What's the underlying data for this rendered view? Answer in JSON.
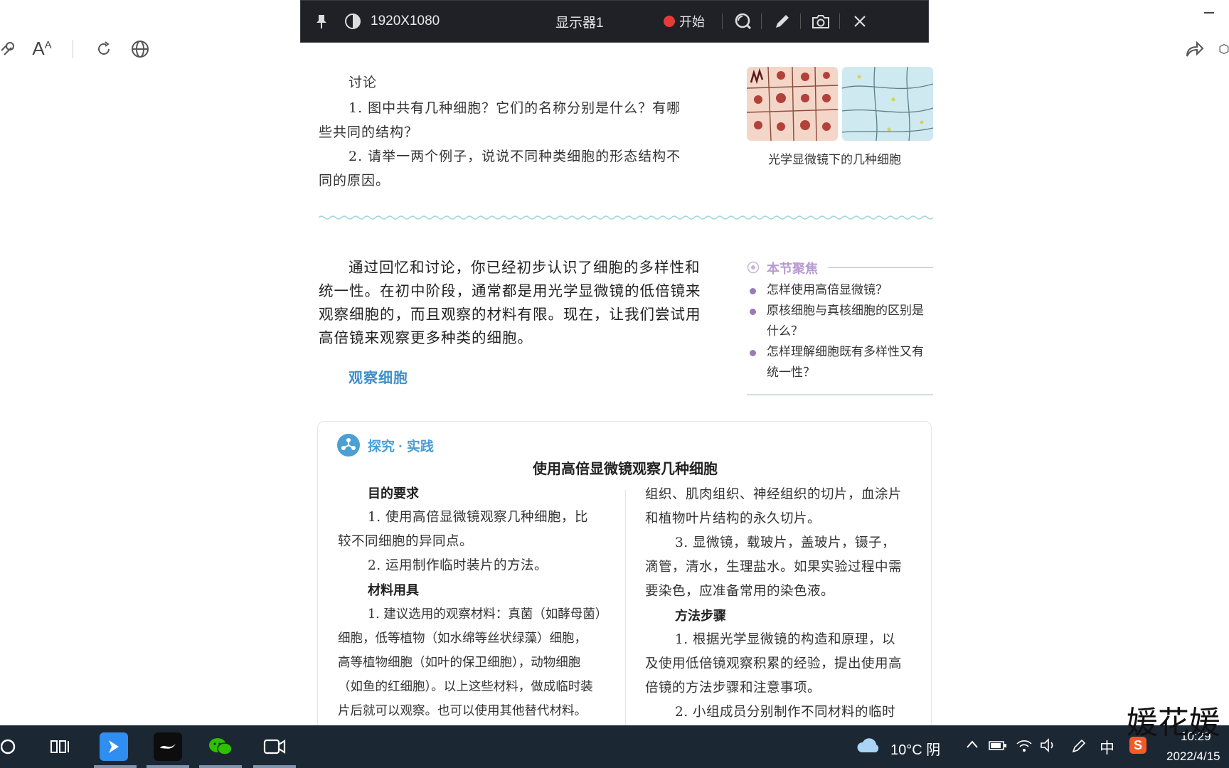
{
  "capture_toolbar": {
    "resolution": "1920X1080",
    "display": "显示器1",
    "record_label": "开始"
  },
  "page": {
    "discussion": {
      "title": "讨论",
      "q1_line1": "1. 图中共有几种细胞？它们的名称分别是什么？有哪",
      "q1_line2": "些共同的结构？",
      "q2_line1": "2. 请举一两个例子，说说不同种类细胞的形态结构不",
      "q2_line2": "同的原因。",
      "figure_caption": "光学显微镜下的几种细胞"
    },
    "intro": {
      "line1": "通过回忆和讨论，你已经初步认识了细胞的多样性和",
      "line2": "统一性。在初中阶段，通常都是用光学显微镜的低倍镜来",
      "line3": "观察细胞的，而且观察的材料有限。现在，让我们尝试用",
      "line4": "高倍镜来观察更多种类的细胞。",
      "section_title": "观察细胞"
    },
    "focus": {
      "title": "本节聚焦",
      "item1": "怎样使用高倍显微镜？",
      "item2_line1": "原核细胞与真核细胞的区别是",
      "item2_line2": "什么？",
      "item3_line1": "怎样理解细胞既有多样性又有",
      "item3_line2": "统一性？"
    },
    "practice": {
      "label": "探究 · 实践",
      "title": "使用高倍显微镜观察几种细胞",
      "left": {
        "goal_title": "目的要求",
        "goal1_line1": "1. 使用高倍显微镜观察几种细胞，比",
        "goal1_line2": "较不同细胞的异同点。",
        "goal2": "2. 运用制作临时装片的方法。",
        "materials_title": "材料用具",
        "m1_line1": "1. 建议选用的观察材料：真菌（如酵母菌）",
        "m1_line2": "细胞，低等植物（如水绵等丝状绿藻）细胞，",
        "m1_line3": "高等植物细胞（如叶的保卫细胞），动物细胞",
        "m1_line4": "（如鱼的红细胞）。以上这些材料，做成临时装",
        "m1_line5": "片后就可以观察。也可以使用其他替代材料。"
      },
      "right": {
        "r1": "组织、肌肉组织、神经组织的切片，血涂片",
        "r2": "和植物叶片结构的永久切片。",
        "r3": "3. 显微镜，载玻片，盖玻片，镊子，",
        "r4": "滴管，清水，生理盐水。如果实验过程中需",
        "r5": "要染色，应准备常用的染色液。",
        "method_title": "方法步骤",
        "s1_line1": "1. 根据光学显微镜的构造和原理，以",
        "s1_line2": "及使用低倍镜观察积累的经验，提出使用高",
        "s1_line3": "倍镜的方法步骤和注意事项。",
        "s2_line1": "2. 小组成员分别制作不同材料的临时"
      }
    }
  },
  "watermark": "媛花媛",
  "taskbar": {
    "weather": "10°C 阴",
    "ime": "中",
    "time": "10:29",
    "date": "2022/4/15"
  },
  "colors": {
    "toolbar_bg": "#1f2126",
    "taskbar_bg": "#1c2734",
    "accent_blue": "#3d8fc9",
    "focus_purple": "#9a7bb8",
    "record_red": "#e83a3a"
  }
}
